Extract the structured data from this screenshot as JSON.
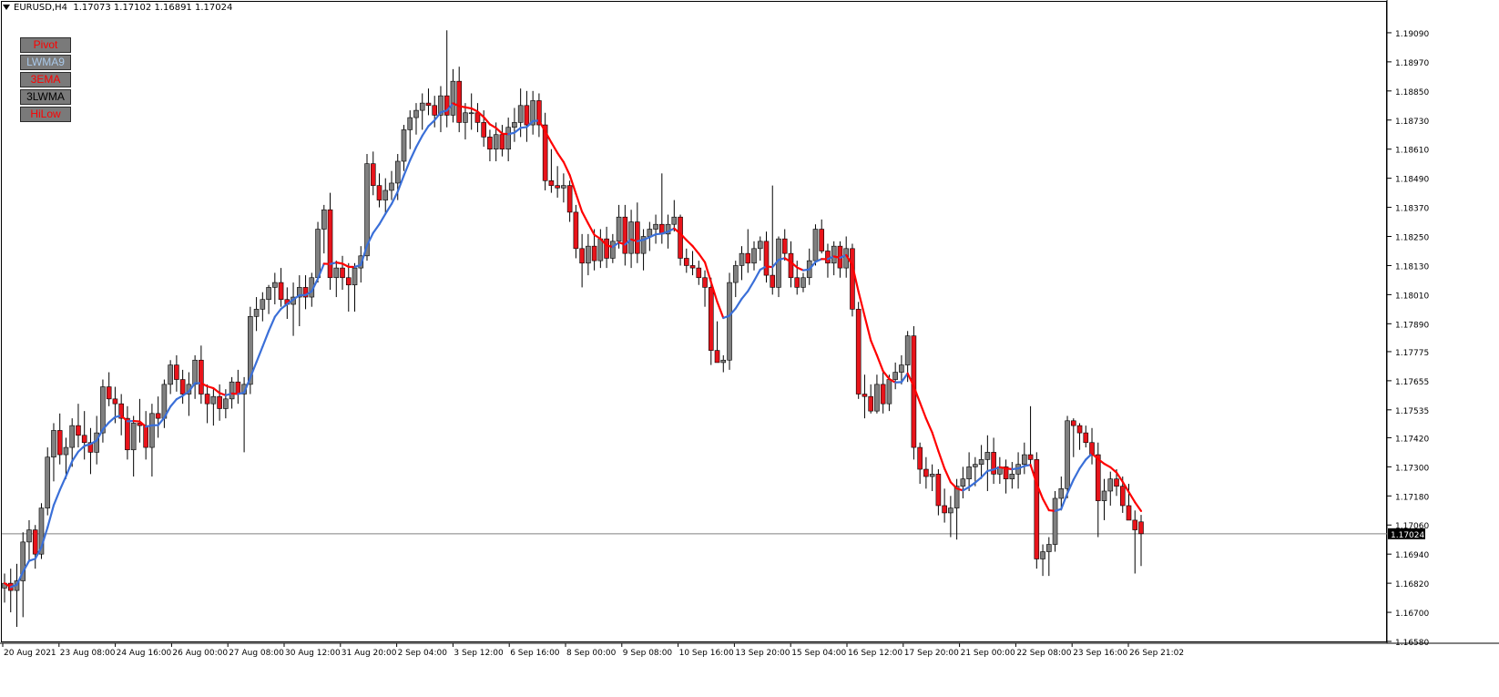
{
  "header": {
    "symbol": "EURUSD,H4",
    "ohlc": "1.17073 1.17102 1.16891 1.17024"
  },
  "indicator_buttons": [
    {
      "label": "Pivot",
      "color": "#ff0000"
    },
    {
      "label": "LWMA9",
      "color": "#a9c8e8"
    },
    {
      "label": "3EMA",
      "color": "#ff0000"
    },
    {
      "label": "3LWMA",
      "color": "#000000"
    },
    {
      "label": "HiLow",
      "color": "#ff0000"
    }
  ],
  "colors": {
    "bull_candle": "#808080",
    "bear_candle": "#e8141b",
    "candle_outline": "#000000",
    "ma_up": "#3a6fd8",
    "ma_down": "#ff0000",
    "price_line": "#808080",
    "price_label_bg": "#000000",
    "price_label_text": "#ffffff"
  },
  "price_axis": {
    "ticks": [
      "1.19090",
      "1.18970",
      "1.18850",
      "1.18730",
      "1.18610",
      "1.18490",
      "1.18370",
      "1.18250",
      "1.18130",
      "1.18010",
      "1.17890",
      "1.17775",
      "1.17655",
      "1.17535",
      "1.17420",
      "1.17300",
      "1.17180",
      "1.17060",
      "1.16940",
      "1.16820",
      "1.16700",
      "1.16580"
    ],
    "current_price": "1.17024"
  },
  "time_axis": {
    "labels": [
      "20 Aug 2021",
      "23 Aug 08:00",
      "24 Aug 16:00",
      "26 Aug 00:00",
      "27 Aug 08:00",
      "30 Aug 12:00",
      "31 Aug 20:00",
      "2 Sep 04:00",
      "3 Sep 12:00",
      "6 Sep 16:00",
      "8 Sep 00:00",
      "9 Sep 08:00",
      "10 Sep 16:00",
      "13 Sep 20:00",
      "15 Sep 04:00",
      "16 Sep 12:00",
      "17 Sep 20:00",
      "21 Sep 00:00",
      "22 Sep 08:00",
      "23 Sep 16:00",
      "26 Sep 21:02"
    ]
  },
  "chart_data": {
    "type": "candlestick",
    "symbol": "EURUSD",
    "timeframe": "H4",
    "ylim": [
      1.1658,
      1.1921
    ],
    "candles": [
      [
        1.168,
        1.1686,
        1.1674,
        1.1682
      ],
      [
        1.1682,
        1.1688,
        1.167,
        1.1679
      ],
      [
        1.1679,
        1.169,
        1.1664,
        1.1683
      ],
      [
        1.1683,
        1.1703,
        1.1668,
        1.1699
      ],
      [
        1.1699,
        1.1708,
        1.1691,
        1.1704
      ],
      [
        1.1704,
        1.1706,
        1.1688,
        1.1694
      ],
      [
        1.1694,
        1.1715,
        1.1692,
        1.1713
      ],
      [
        1.1713,
        1.1738,
        1.171,
        1.1734
      ],
      [
        1.1734,
        1.1748,
        1.1724,
        1.1745
      ],
      [
        1.1745,
        1.1752,
        1.1731,
        1.1735
      ],
      [
        1.1735,
        1.1742,
        1.1725,
        1.1738
      ],
      [
        1.1738,
        1.175,
        1.173,
        1.1747
      ],
      [
        1.1747,
        1.1756,
        1.1738,
        1.1743
      ],
      [
        1.1743,
        1.1753,
        1.1733,
        1.174
      ],
      [
        1.174,
        1.1746,
        1.1727,
        1.1736
      ],
      [
        1.1736,
        1.1751,
        1.1731,
        1.1744
      ],
      [
        1.1744,
        1.1766,
        1.174,
        1.1763
      ],
      [
        1.1763,
        1.1769,
        1.1755,
        1.1758
      ],
      [
        1.1758,
        1.1763,
        1.1748,
        1.1756
      ],
      [
        1.1756,
        1.176,
        1.1743,
        1.175
      ],
      [
        1.175,
        1.1755,
        1.1733,
        1.1737
      ],
      [
        1.1737,
        1.1751,
        1.1726,
        1.1748
      ],
      [
        1.1748,
        1.1758,
        1.174,
        1.1747
      ],
      [
        1.1747,
        1.1753,
        1.1733,
        1.1738
      ],
      [
        1.1738,
        1.1756,
        1.1726,
        1.1752
      ],
      [
        1.1752,
        1.1759,
        1.1742,
        1.175
      ],
      [
        1.175,
        1.1766,
        1.1746,
        1.1764
      ],
      [
        1.1764,
        1.1774,
        1.176,
        1.1772
      ],
      [
        1.1772,
        1.1776,
        1.1761,
        1.1766
      ],
      [
        1.1766,
        1.177,
        1.1756,
        1.176
      ],
      [
        1.176,
        1.1769,
        1.1751,
        1.1764
      ],
      [
        1.1764,
        1.1776,
        1.1758,
        1.1774
      ],
      [
        1.1774,
        1.178,
        1.1756,
        1.176
      ],
      [
        1.176,
        1.1764,
        1.1748,
        1.1756
      ],
      [
        1.1756,
        1.1762,
        1.1747,
        1.1759
      ],
      [
        1.1759,
        1.1764,
        1.1749,
        1.1754
      ],
      [
        1.1754,
        1.1762,
        1.175,
        1.1758
      ],
      [
        1.1758,
        1.1767,
        1.1754,
        1.1765
      ],
      [
        1.1765,
        1.177,
        1.1756,
        1.176
      ],
      [
        1.176,
        1.1767,
        1.1736,
        1.1764
      ],
      [
        1.1764,
        1.1796,
        1.176,
        1.1792
      ],
      [
        1.1792,
        1.18,
        1.1786,
        1.1795
      ],
      [
        1.1795,
        1.1802,
        1.179,
        1.1799
      ],
      [
        1.1799,
        1.1805,
        1.1793,
        1.1804
      ],
      [
        1.1804,
        1.181,
        1.1797,
        1.1806
      ],
      [
        1.1806,
        1.1812,
        1.1796,
        1.1799
      ],
      [
        1.1799,
        1.1804,
        1.1791,
        1.1797
      ],
      [
        1.1797,
        1.1806,
        1.1784,
        1.18
      ],
      [
        1.18,
        1.1809,
        1.1788,
        1.1804
      ],
      [
        1.1804,
        1.1809,
        1.1795,
        1.18
      ],
      [
        1.18,
        1.181,
        1.1796,
        1.1808
      ],
      [
        1.1808,
        1.1831,
        1.1806,
        1.1828
      ],
      [
        1.1828,
        1.1838,
        1.1818,
        1.1836
      ],
      [
        1.1836,
        1.1843,
        1.1803,
        1.1808
      ],
      [
        1.1808,
        1.1815,
        1.18,
        1.1812
      ],
      [
        1.1812,
        1.1817,
        1.1803,
        1.1808
      ],
      [
        1.1808,
        1.1814,
        1.1794,
        1.1805
      ],
      [
        1.1805,
        1.1814,
        1.1794,
        1.1812
      ],
      [
        1.1812,
        1.1821,
        1.1806,
        1.1817
      ],
      [
        1.1817,
        1.1859,
        1.1815,
        1.1855
      ],
      [
        1.1855,
        1.186,
        1.1842,
        1.1846
      ],
      [
        1.1846,
        1.1851,
        1.1837,
        1.184
      ],
      [
        1.184,
        1.1849,
        1.1834,
        1.1844
      ],
      [
        1.1844,
        1.1852,
        1.184,
        1.1847
      ],
      [
        1.1847,
        1.1859,
        1.184,
        1.1856
      ],
      [
        1.1856,
        1.1871,
        1.1852,
        1.1869
      ],
      [
        1.1869,
        1.1877,
        1.1861,
        1.1874
      ],
      [
        1.1874,
        1.188,
        1.1867,
        1.1877
      ],
      [
        1.1877,
        1.1884,
        1.1869,
        1.188
      ],
      [
        1.188,
        1.1886,
        1.1875,
        1.1879
      ],
      [
        1.1879,
        1.1883,
        1.187,
        1.1875
      ],
      [
        1.1875,
        1.1887,
        1.1868,
        1.1883
      ],
      [
        1.1883,
        1.191,
        1.187,
        1.1875
      ],
      [
        1.1875,
        1.1894,
        1.1872,
        1.1889
      ],
      [
        1.1889,
        1.1895,
        1.1868,
        1.1872
      ],
      [
        1.1872,
        1.188,
        1.1865,
        1.1876
      ],
      [
        1.1876,
        1.1884,
        1.1869,
        1.1876
      ],
      [
        1.1876,
        1.188,
        1.1868,
        1.1872
      ],
      [
        1.1872,
        1.1877,
        1.1862,
        1.1866
      ],
      [
        1.1866,
        1.1869,
        1.1856,
        1.1861
      ],
      [
        1.1861,
        1.1872,
        1.1856,
        1.1867
      ],
      [
        1.1867,
        1.1871,
        1.1858,
        1.1861
      ],
      [
        1.1861,
        1.1874,
        1.1856,
        1.187
      ],
      [
        1.187,
        1.1878,
        1.1864,
        1.1872
      ],
      [
        1.1872,
        1.1886,
        1.1866,
        1.1879
      ],
      [
        1.1879,
        1.1885,
        1.1864,
        1.1871
      ],
      [
        1.1871,
        1.1885,
        1.1867,
        1.1881
      ],
      [
        1.1881,
        1.1884,
        1.1866,
        1.1871
      ],
      [
        1.1871,
        1.1876,
        1.1844,
        1.1848
      ],
      [
        1.1848,
        1.1861,
        1.1843,
        1.1846
      ],
      [
        1.1846,
        1.1854,
        1.1841,
        1.1845
      ],
      [
        1.1845,
        1.1851,
        1.1839,
        1.1846
      ],
      [
        1.1846,
        1.1848,
        1.1831,
        1.1835
      ],
      [
        1.1835,
        1.1838,
        1.1816,
        1.182
      ],
      [
        1.182,
        1.1826,
        1.1804,
        1.1814
      ],
      [
        1.1814,
        1.1826,
        1.1809,
        1.1821
      ],
      [
        1.1821,
        1.1828,
        1.1811,
        1.1815
      ],
      [
        1.1815,
        1.1828,
        1.1812,
        1.1824
      ],
      [
        1.1824,
        1.1829,
        1.1812,
        1.1816
      ],
      [
        1.1816,
        1.1826,
        1.1814,
        1.1823
      ],
      [
        1.1823,
        1.1838,
        1.182,
        1.1833
      ],
      [
        1.1833,
        1.1838,
        1.1813,
        1.1818
      ],
      [
        1.1818,
        1.1836,
        1.1812,
        1.1831
      ],
      [
        1.1831,
        1.1839,
        1.1814,
        1.1818
      ],
      [
        1.1818,
        1.1828,
        1.1811,
        1.1825
      ],
      [
        1.1825,
        1.1831,
        1.1819,
        1.1828
      ],
      [
        1.1828,
        1.1834,
        1.1822,
        1.183
      ],
      [
        1.183,
        1.1851,
        1.1822,
        1.1826
      ],
      [
        1.1826,
        1.1834,
        1.182,
        1.183
      ],
      [
        1.183,
        1.184,
        1.1827,
        1.1833
      ],
      [
        1.1833,
        1.1834,
        1.1813,
        1.1816
      ],
      [
        1.1816,
        1.182,
        1.181,
        1.1813
      ],
      [
        1.1813,
        1.1819,
        1.1809,
        1.1812
      ],
      [
        1.1812,
        1.1815,
        1.1805,
        1.1808
      ],
      [
        1.1808,
        1.1811,
        1.1796,
        1.1804
      ],
      [
        1.1804,
        1.1808,
        1.1772,
        1.1778
      ],
      [
        1.1778,
        1.179,
        1.1773,
        1.1773
      ],
      [
        1.1773,
        1.1776,
        1.1769,
        1.1774
      ],
      [
        1.1774,
        1.181,
        1.177,
        1.1806
      ],
      [
        1.1806,
        1.1815,
        1.18,
        1.1813
      ],
      [
        1.1813,
        1.1821,
        1.1807,
        1.1818
      ],
      [
        1.1818,
        1.1828,
        1.181,
        1.1814
      ],
      [
        1.1814,
        1.1823,
        1.1811,
        1.182
      ],
      [
        1.182,
        1.1825,
        1.1815,
        1.1823
      ],
      [
        1.1823,
        1.1827,
        1.1806,
        1.1809
      ],
      [
        1.1809,
        1.1846,
        1.1801,
        1.1804
      ],
      [
        1.1804,
        1.1825,
        1.18,
        1.1824
      ],
      [
        1.1824,
        1.1828,
        1.1815,
        1.1818
      ],
      [
        1.1818,
        1.1823,
        1.1804,
        1.1808
      ],
      [
        1.1808,
        1.1815,
        1.1801,
        1.1804
      ],
      [
        1.1804,
        1.181,
        1.1802,
        1.1808
      ],
      [
        1.1808,
        1.182,
        1.1805,
        1.1815
      ],
      [
        1.1815,
        1.183,
        1.1813,
        1.1828
      ],
      [
        1.1828,
        1.1832,
        1.1818,
        1.1819
      ],
      [
        1.1819,
        1.1822,
        1.1808,
        1.1814
      ],
      [
        1.1814,
        1.1823,
        1.1809,
        1.1821
      ],
      [
        1.1821,
        1.1823,
        1.1808,
        1.1812
      ],
      [
        1.1812,
        1.1825,
        1.1808,
        1.182
      ],
      [
        1.182,
        1.1822,
        1.1792,
        1.1795
      ],
      [
        1.1795,
        1.1798,
        1.1758,
        1.176
      ],
      [
        1.176,
        1.1768,
        1.175,
        1.1759
      ],
      [
        1.1759,
        1.1764,
        1.1752,
        1.1753
      ],
      [
        1.1753,
        1.1768,
        1.1752,
        1.1764
      ],
      [
        1.1764,
        1.1769,
        1.1752,
        1.1756
      ],
      [
        1.1756,
        1.1768,
        1.1753,
        1.1766
      ],
      [
        1.1766,
        1.1773,
        1.1762,
        1.1769
      ],
      [
        1.1769,
        1.1776,
        1.1764,
        1.1772
      ],
      [
        1.1772,
        1.1786,
        1.1765,
        1.1784
      ],
      [
        1.1784,
        1.1788,
        1.1733,
        1.1738
      ],
      [
        1.1738,
        1.174,
        1.1723,
        1.1729
      ],
      [
        1.1729,
        1.1734,
        1.1721,
        1.1726
      ],
      [
        1.1726,
        1.1731,
        1.172,
        1.1727
      ],
      [
        1.1727,
        1.1729,
        1.171,
        1.1714
      ],
      [
        1.1714,
        1.1721,
        1.1707,
        1.1711
      ],
      [
        1.1711,
        1.1718,
        1.1701,
        1.1713
      ],
      [
        1.1713,
        1.1725,
        1.17,
        1.1722
      ],
      [
        1.1722,
        1.173,
        1.1717,
        1.1725
      ],
      [
        1.1725,
        1.1736,
        1.172,
        1.173
      ],
      [
        1.173,
        1.1734,
        1.1722,
        1.1731
      ],
      [
        1.1731,
        1.1739,
        1.1725,
        1.1733
      ],
      [
        1.1733,
        1.1743,
        1.172,
        1.1736
      ],
      [
        1.1736,
        1.1742,
        1.1723,
        1.1727
      ],
      [
        1.1727,
        1.1734,
        1.1723,
        1.173
      ],
      [
        1.173,
        1.1733,
        1.1719,
        1.1725
      ],
      [
        1.1725,
        1.1732,
        1.1721,
        1.1727
      ],
      [
        1.1727,
        1.1736,
        1.1721,
        1.1731
      ],
      [
        1.1731,
        1.174,
        1.1727,
        1.1735
      ],
      [
        1.1735,
        1.1755,
        1.173,
        1.1733
      ],
      [
        1.1733,
        1.1736,
        1.1688,
        1.1692
      ],
      [
        1.1692,
        1.1698,
        1.1685,
        1.1695
      ],
      [
        1.1695,
        1.1701,
        1.1685,
        1.1698
      ],
      [
        1.1698,
        1.172,
        1.1695,
        1.1717
      ],
      [
        1.1717,
        1.1726,
        1.1712,
        1.1721
      ],
      [
        1.1721,
        1.1751,
        1.1717,
        1.1749
      ],
      [
        1.1749,
        1.175,
        1.1734,
        1.1747
      ],
      [
        1.1747,
        1.1748,
        1.1737,
        1.1744
      ],
      [
        1.1744,
        1.1747,
        1.1738,
        1.174
      ],
      [
        1.174,
        1.1746,
        1.1731,
        1.1735
      ],
      [
        1.1735,
        1.174,
        1.1701,
        1.1716
      ],
      [
        1.1716,
        1.1725,
        1.1708,
        1.172
      ],
      [
        1.172,
        1.1728,
        1.1714,
        1.1725
      ],
      [
        1.1725,
        1.1729,
        1.1718,
        1.1722
      ],
      [
        1.1722,
        1.1726,
        1.1711,
        1.1714
      ],
      [
        1.1714,
        1.1723,
        1.1709,
        1.1708
      ],
      [
        1.1708,
        1.1712,
        1.1686,
        1.1704
      ],
      [
        1.17073,
        1.17102,
        1.16891,
        1.17024
      ]
    ]
  }
}
